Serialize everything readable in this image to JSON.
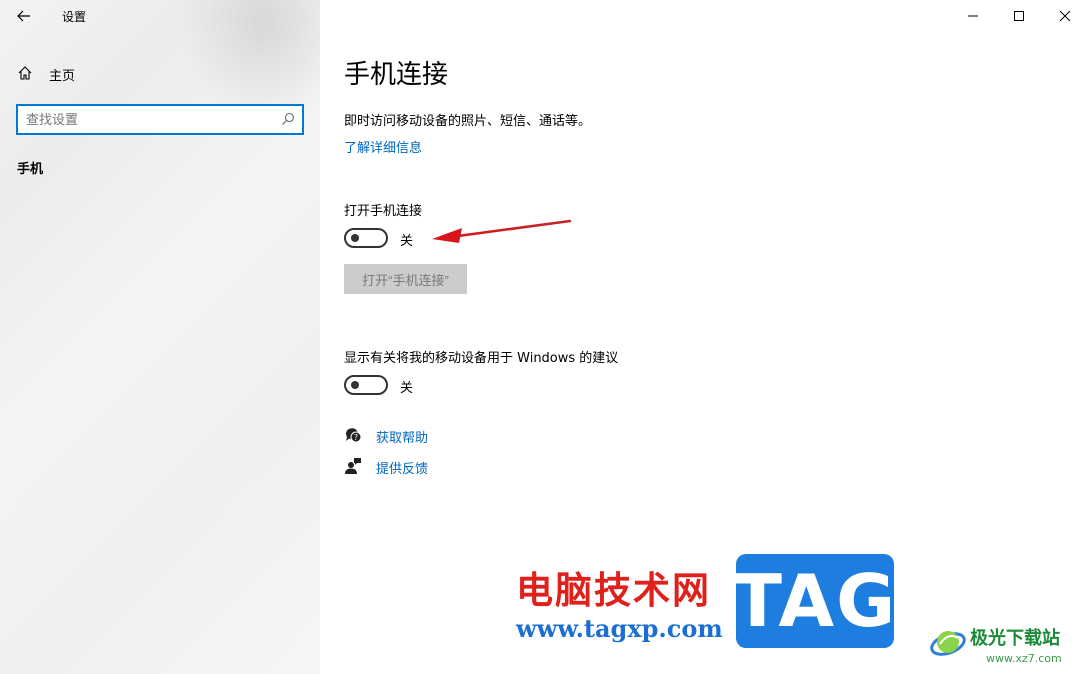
{
  "window": {
    "title": "设置",
    "controls": [
      "minimize-icon",
      "maximize-icon",
      "close-icon"
    ]
  },
  "sidebar": {
    "home_label": "主页",
    "search": {
      "placeholder": "查找设置",
      "value": ""
    },
    "section": "手机"
  },
  "main": {
    "title": "手机连接",
    "description": "即时访问移动设备的照片、短信、通话等。",
    "learn_more": "了解详细信息",
    "phone_link": {
      "label": "打开手机连接",
      "state": "关",
      "button": "打开“手机连接”"
    },
    "suggestions": {
      "label": "显示有关将我的移动设备用于 Windows 的建议",
      "state": "关"
    },
    "help": {
      "get_help": "获取帮助",
      "feedback": "提供反馈"
    }
  },
  "watermark": {
    "site_cn": "电脑技术网",
    "site_url": "www.tagxp.com",
    "tag": "TAG",
    "brand2_name": "极光下载站",
    "brand2_url": "www.xz7.com"
  },
  "colors": {
    "accent": "#0078d7",
    "link": "#0067c0",
    "annotation_arrow": "#d9141b"
  }
}
